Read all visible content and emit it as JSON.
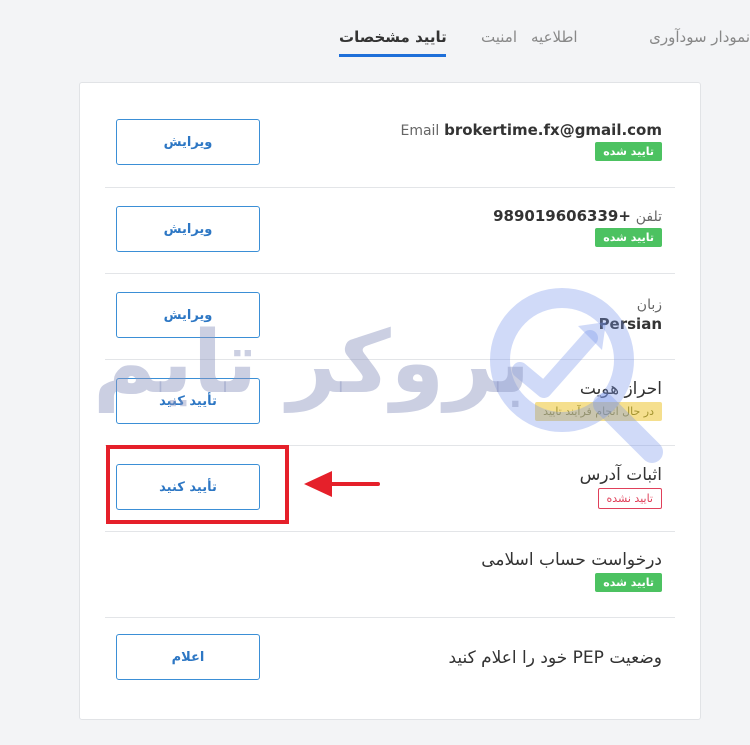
{
  "tabs": {
    "profit_chart": "نمودار سودآوری",
    "notifications": "اطلاعیه",
    "security": "امنیت",
    "verification": "تایید مشخصات"
  },
  "rows": {
    "email": {
      "label": "Email",
      "value": "brokertime.fx@gmail.com",
      "status": "تایید شده",
      "button": "ویرایش"
    },
    "phone": {
      "label": "تلفن",
      "value": "+989019606339",
      "status": "تایید شده",
      "button": "ویرایش"
    },
    "language": {
      "label": "زبان",
      "value": "Persian",
      "button": "ویرایش"
    },
    "identity": {
      "label": "احراز هویت",
      "status": "در حال انجام فرآیند تایید",
      "button": "تأیید کنید"
    },
    "address": {
      "label": "اثبات آدرس",
      "status": "تایید نشده",
      "button": "تأیید کنید"
    },
    "islamic": {
      "label": "درخواست حساب اسلامی",
      "status": "تایید شده"
    },
    "pep": {
      "label": "وضعیت PEP خود را اعلام کنید",
      "button": "اعلام"
    }
  },
  "watermark": {
    "text": "بروکر تایم"
  },
  "colors": {
    "accent": "#1e6fd9",
    "verified": "#4cc261",
    "pending": "#f5df8e",
    "unverified": "#e0405a",
    "highlight": "#e5202a"
  }
}
